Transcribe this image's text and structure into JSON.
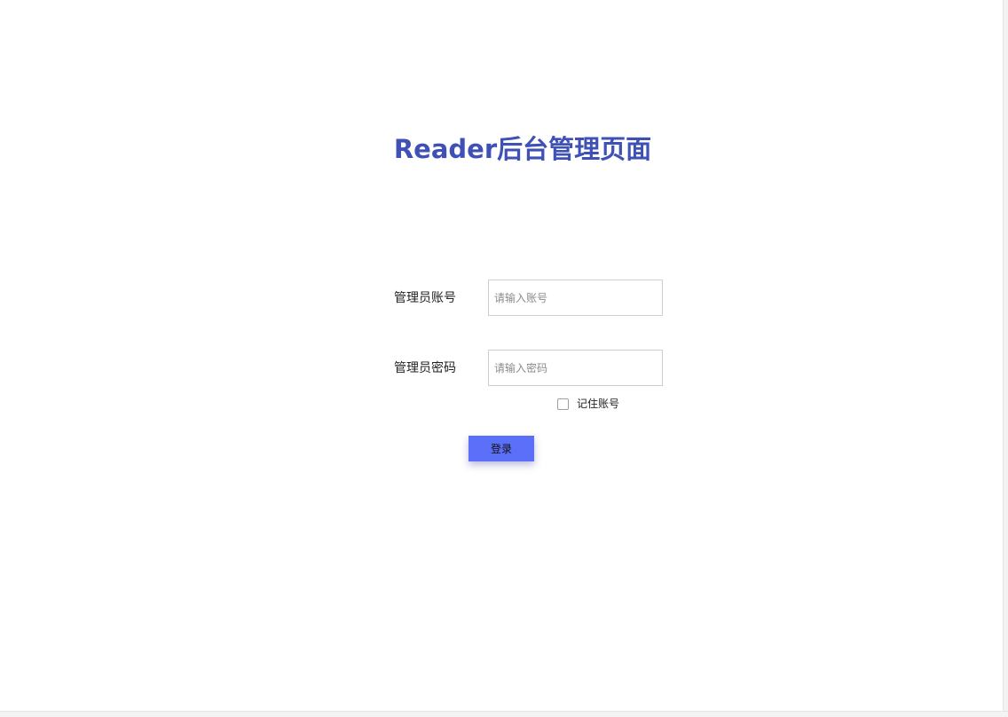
{
  "header": {
    "title": "Reader后台管理页面"
  },
  "form": {
    "account": {
      "label": "管理员账号",
      "value": "",
      "placeholder": "请输入账号"
    },
    "password": {
      "label": "管理员密码",
      "value": "",
      "placeholder": "请输入密码"
    },
    "remember": {
      "label": "记住账号",
      "checked": false
    },
    "submit_label": "登录"
  },
  "colors": {
    "title": "#3f51b5",
    "button": "#5c6ff8"
  }
}
